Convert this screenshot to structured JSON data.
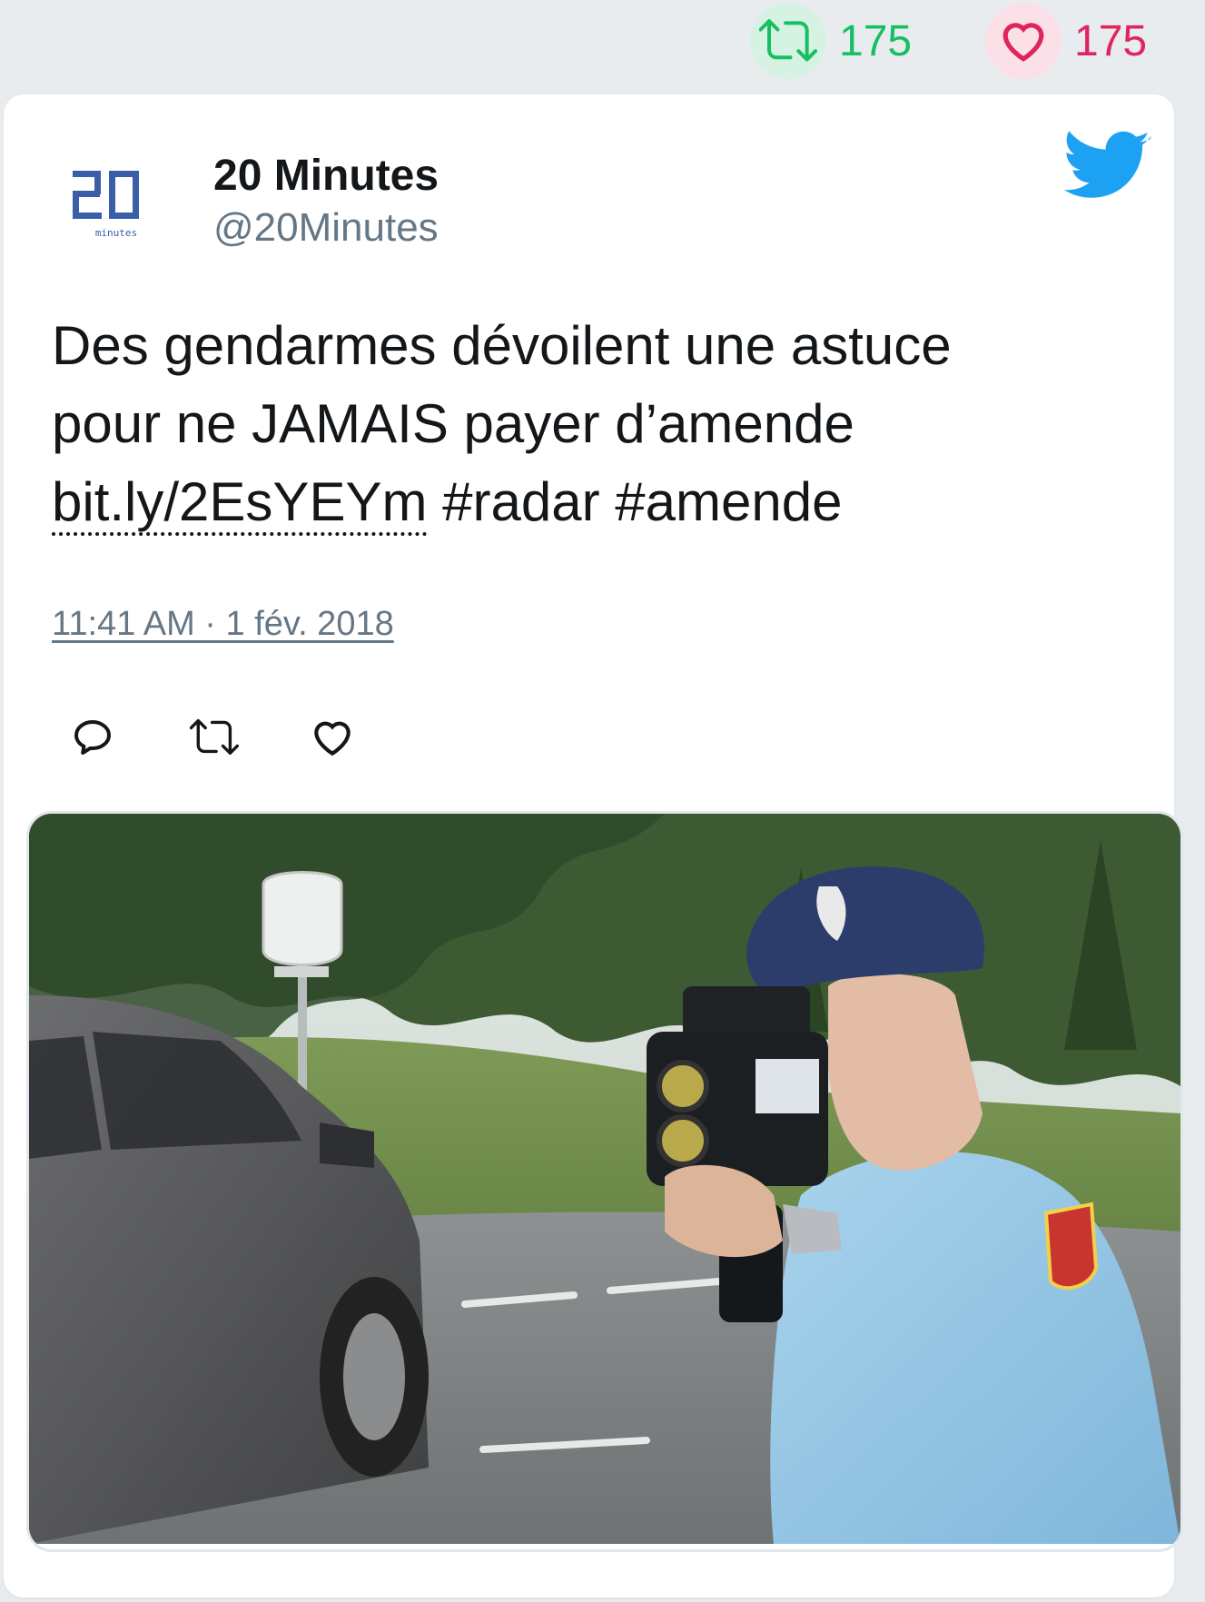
{
  "engagement": {
    "retweet_count": "175",
    "like_count": "175",
    "colors": {
      "retweet": "#17bf63",
      "like": "#e0245e"
    }
  },
  "tweet": {
    "author_name": "20 Minutes",
    "author_handle": "@20Minutes",
    "avatar": {
      "logo_text": "20",
      "logo_subtext": "minutes"
    },
    "text_lines": [
      "Des gendarmes dévoilent une astuce",
      "pour ne JAMAIS payer d’amende"
    ],
    "link": "bit.ly/2EsYEYm",
    "hashtags": " #radar #amende",
    "timestamp": "11:41 AM · 1 fév. 2018",
    "actions": [
      "reply-icon",
      "retweet-icon",
      "like-icon"
    ],
    "brand_icon": "twitter-bird-icon",
    "brand_color": "#1da1f2",
    "media": {
      "description_icon": "photo"
    }
  }
}
